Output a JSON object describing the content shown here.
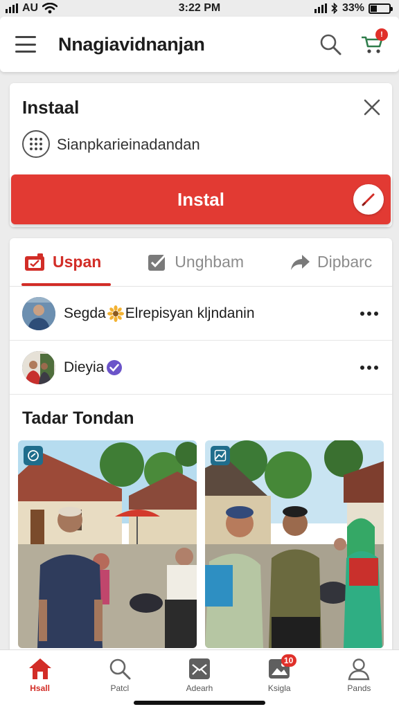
{
  "status_bar": {
    "carrier": "AU",
    "time": "3:22 PM",
    "battery": "33%"
  },
  "header": {
    "title": "Nnagiavidnanjan",
    "cart_badge": "!"
  },
  "install_card": {
    "title": "Instaal",
    "subtitle": "Sianpkarieinadandan",
    "button_label": "Instal"
  },
  "tabs": [
    {
      "label": "Uspan",
      "icon": "tab-folder-icon",
      "active": true
    },
    {
      "label": "Unghbam",
      "icon": "checkbox-icon",
      "active": false
    },
    {
      "label": "Dipbarc",
      "icon": "share-arrow-icon",
      "active": false
    }
  ],
  "feed": {
    "rows": [
      {
        "name_before": "Segda",
        "badge": "sunflower",
        "name_after": "Elrepisyan kljndanin"
      },
      {
        "name": "Dieyia",
        "badge": "verified"
      }
    ],
    "section_title": "Tadar Tondan"
  },
  "bottom_nav": [
    {
      "label": "Hsall",
      "icon": "home-icon",
      "active": true
    },
    {
      "label": "Patcl",
      "icon": "search-icon",
      "active": false
    },
    {
      "label": "Adearh",
      "icon": "mail-icon",
      "active": false
    },
    {
      "label": "Ksigla",
      "icon": "photo-icon",
      "active": false,
      "badge": "10"
    },
    {
      "label": "Pands",
      "icon": "profile-icon",
      "active": false
    }
  ],
  "colors": {
    "accent": "#d22d27",
    "button": "#e23a33",
    "badge": "#e0302a"
  }
}
